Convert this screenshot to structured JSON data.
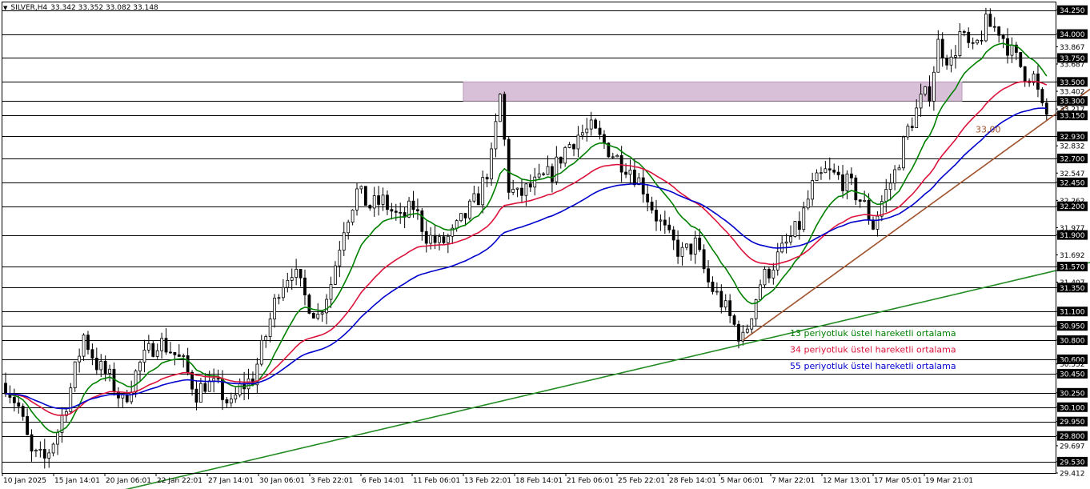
{
  "header": {
    "menu_icon": "triangle-down-icon",
    "symbol": "SILVER,H4",
    "ohlc": "33.342 33.352 33.082 33.148"
  },
  "chart_data": {
    "type": "line",
    "title": "SILVER,H4 33.342 33.352 33.082 33.148",
    "ylim": [
      29.412,
      34.331
    ],
    "y_ticks": [
      "34.250",
      "34.000",
      "33.867",
      "33.750",
      "33.687",
      "33.500",
      "33.402",
      "33.300",
      "33.217",
      "33.150",
      "32.930",
      "32.832",
      "32.700",
      "32.547",
      "32.450",
      "32.262",
      "32.200",
      "31.977",
      "31.900",
      "31.692",
      "31.570",
      "31.407",
      "31.350",
      "31.100",
      "30.950",
      "30.800",
      "30.600",
      "30.552",
      "30.450",
      "30.250",
      "30.100",
      "29.950",
      "29.800",
      "29.697",
      "29.530",
      "29.412"
    ],
    "highlighted_y_ticks": [
      "34.250",
      "34.000",
      "33.750",
      "33.500",
      "33.300",
      "33.150",
      "32.930",
      "32.700",
      "32.450",
      "32.200",
      "31.900",
      "31.570",
      "31.350",
      "31.100",
      "30.950",
      "30.800",
      "30.600",
      "30.450",
      "30.250",
      "30.100",
      "29.950",
      "29.800",
      "29.530"
    ],
    "horizontal_levels": [
      34.25,
      34.0,
      33.75,
      33.5,
      33.3,
      33.15,
      32.93,
      32.7,
      32.45,
      32.2,
      31.9,
      31.57,
      31.35,
      31.1,
      30.95,
      30.8,
      30.6,
      30.45,
      30.25,
      30.1,
      29.95,
      29.8,
      29.53
    ],
    "x_ticks": [
      "10 Jan 2025",
      "15 Jan 14:01",
      "20 Jan 06:01",
      "22 Jan 22:01",
      "27 Jan 14:01",
      "30 Jan 06:01",
      "3 Feb 22:01",
      "6 Feb 14:01",
      "11 Feb 06:01",
      "13 Feb 22:01",
      "18 Feb 14:01",
      "21 Feb 06:01",
      "25 Feb 22:01",
      "28 Feb 14:01",
      "5 Mar 06:01",
      "7 Mar 22:01",
      "12 Mar 13:01",
      "17 Mar 05:01",
      "19 Mar 21:01"
    ],
    "resistance_zone": [
      33.3,
      33.5
    ],
    "trendline_label": "33,00",
    "price_anchors": [
      [
        0,
        30.35
      ],
      [
        3,
        30.1
      ],
      [
        6,
        29.6
      ],
      [
        9,
        29.55
      ],
      [
        12,
        29.85
      ],
      [
        15,
        30.3
      ],
      [
        18,
        30.85
      ],
      [
        21,
        30.55
      ],
      [
        24,
        30.4
      ],
      [
        27,
        30.15
      ],
      [
        31,
        30.55
      ],
      [
        35,
        30.8
      ],
      [
        38,
        30.7
      ],
      [
        41,
        30.55
      ],
      [
        44,
        30.25
      ],
      [
        46,
        30.35
      ],
      [
        49,
        30.3
      ],
      [
        52,
        30.1
      ],
      [
        54,
        30.3
      ],
      [
        57,
        30.4
      ],
      [
        60,
        30.85
      ],
      [
        63,
        31.35
      ],
      [
        66,
        31.55
      ],
      [
        69,
        31.25
      ],
      [
        72,
        31.05
      ],
      [
        75,
        31.4
      ],
      [
        78,
        32.0
      ],
      [
        81,
        32.35
      ],
      [
        84,
        32.2
      ],
      [
        87,
        32.25
      ],
      [
        91,
        32.05
      ],
      [
        94,
        32.2
      ],
      [
        97,
        31.9
      ],
      [
        100,
        31.8
      ],
      [
        103,
        31.9
      ],
      [
        106,
        32.1
      ],
      [
        109,
        32.3
      ],
      [
        112,
        32.7
      ],
      [
        114,
        33.35
      ],
      [
        116,
        32.4
      ],
      [
        118,
        32.3
      ],
      [
        121,
        32.4
      ],
      [
        123,
        32.45
      ],
      [
        126,
        32.55
      ],
      [
        129,
        32.8
      ],
      [
        132,
        32.95
      ],
      [
        135,
        33.0
      ],
      [
        138,
        32.85
      ],
      [
        141,
        32.7
      ],
      [
        144,
        32.6
      ],
      [
        147,
        32.4
      ],
      [
        150,
        32.1
      ],
      [
        153,
        31.85
      ],
      [
        156,
        31.7
      ],
      [
        159,
        31.8
      ],
      [
        162,
        31.4
      ],
      [
        165,
        31.2
      ],
      [
        168,
        30.95
      ],
      [
        170,
        30.8
      ],
      [
        172,
        31.1
      ],
      [
        174,
        31.4
      ],
      [
        177,
        31.6
      ],
      [
        180,
        31.8
      ],
      [
        183,
        32.0
      ],
      [
        186,
        32.4
      ],
      [
        189,
        32.55
      ],
      [
        192,
        32.5
      ],
      [
        195,
        32.4
      ],
      [
        198,
        32.2
      ],
      [
        200,
        32.0
      ],
      [
        202,
        32.25
      ],
      [
        205,
        32.55
      ],
      [
        208,
        33.0
      ],
      [
        211,
        33.3
      ],
      [
        213,
        33.4
      ],
      [
        215,
        33.9
      ],
      [
        218,
        33.7
      ],
      [
        220,
        34.0
      ],
      [
        223,
        33.8
      ],
      [
        226,
        34.1
      ],
      [
        229,
        34.05
      ],
      [
        232,
        33.8
      ],
      [
        235,
        33.6
      ],
      [
        237,
        33.55
      ],
      [
        239,
        33.2
      ],
      [
        240,
        33.15
      ]
    ],
    "series": [
      {
        "name": "13 periyotluk üstel hareketli ortalama",
        "color": "#008000",
        "period": 13
      },
      {
        "name": "34 periyotluk üstel hareketli ortalama",
        "color": "#dc143c",
        "period": 34
      },
      {
        "name": "55 periyotluk üstel hareketli ortalama",
        "color": "#0000cd",
        "period": 55
      }
    ],
    "trendlines": [
      {
        "name": "long-term-support",
        "color": "#228b22",
        "from": [
          24,
          29.2
        ],
        "to": [
          263,
          31.75
        ]
      },
      {
        "name": "short-term-support",
        "color": "#a0522d",
        "from": [
          170,
          30.8
        ],
        "to": [
          263,
          33.85
        ]
      }
    ],
    "colors": {
      "candle": "#000000",
      "zone": "#d8c0d8",
      "grid": "#000000",
      "label_bg": "#000000",
      "label_fg": "#ffffff",
      "trendline_label": "#a0522d"
    }
  }
}
